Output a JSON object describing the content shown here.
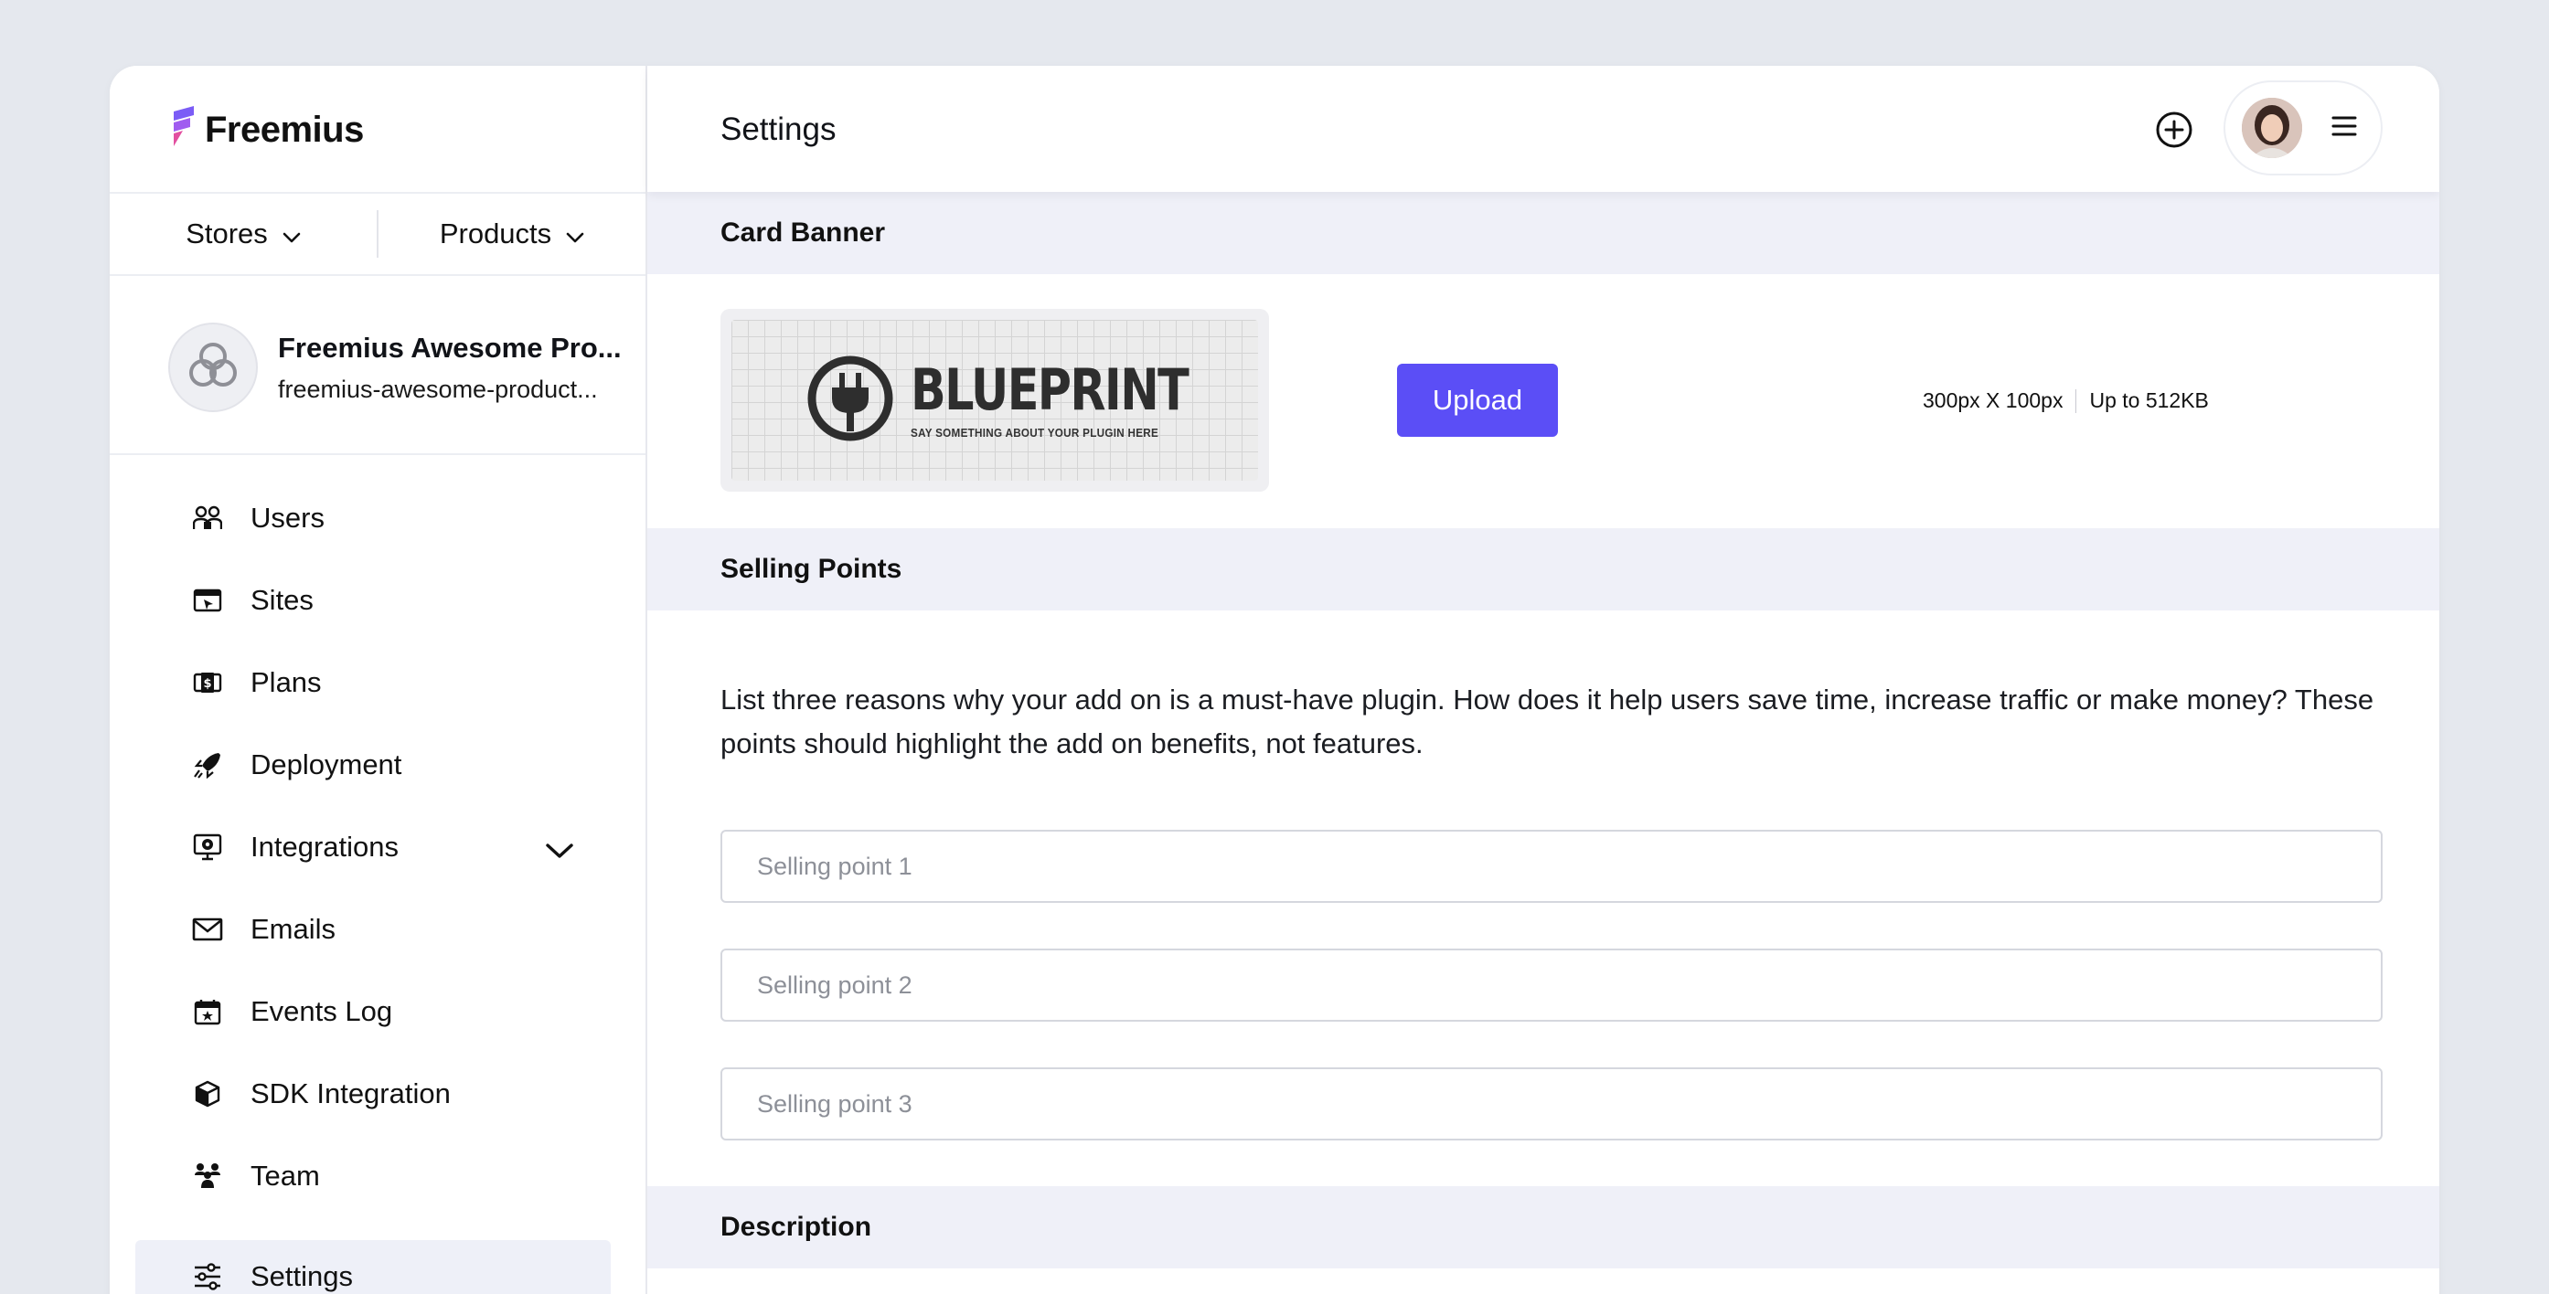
{
  "brand": {
    "name": "Freemius",
    "accent": "#5b4ef6"
  },
  "switcher": {
    "stores_label": "Stores",
    "products_label": "Products"
  },
  "product": {
    "name": "Freemius Awesome Pro...",
    "slug": "freemius-awesome-product..."
  },
  "nav": {
    "items": [
      {
        "label": "Users",
        "icon": "users-icon"
      },
      {
        "label": "Sites",
        "icon": "sites-icon"
      },
      {
        "label": "Plans",
        "icon": "plans-icon"
      },
      {
        "label": "Deployment",
        "icon": "rocket-icon"
      },
      {
        "label": "Integrations",
        "icon": "integrations-icon"
      },
      {
        "label": "Emails",
        "icon": "mail-icon"
      },
      {
        "label": "Events Log",
        "icon": "calendar-icon"
      },
      {
        "label": "SDK Integration",
        "icon": "cube-icon"
      },
      {
        "label": "Team",
        "icon": "team-icon"
      },
      {
        "label": "Settings",
        "icon": "sliders-icon",
        "active": true
      }
    ]
  },
  "header": {
    "title": "Settings"
  },
  "card_banner": {
    "heading": "Card Banner",
    "image_title": "BLUEPRINT",
    "image_subtitle": "SAY SOMETHING ABOUT YOUR PLUGIN HERE",
    "upload_label": "Upload",
    "dimensions": "300px X 100px",
    "max_size": "Up to 512KB"
  },
  "selling_points": {
    "heading": "Selling Points",
    "description": "List three reasons why your add on is a must-have plugin. How does it help users save time, increase traffic or make money? These points should highlight the add on benefits, not features.",
    "inputs": [
      {
        "placeholder": "Selling point 1",
        "value": ""
      },
      {
        "placeholder": "Selling point 2",
        "value": ""
      },
      {
        "placeholder": "Selling point 3",
        "value": ""
      }
    ]
  },
  "description": {
    "heading": "Description"
  }
}
